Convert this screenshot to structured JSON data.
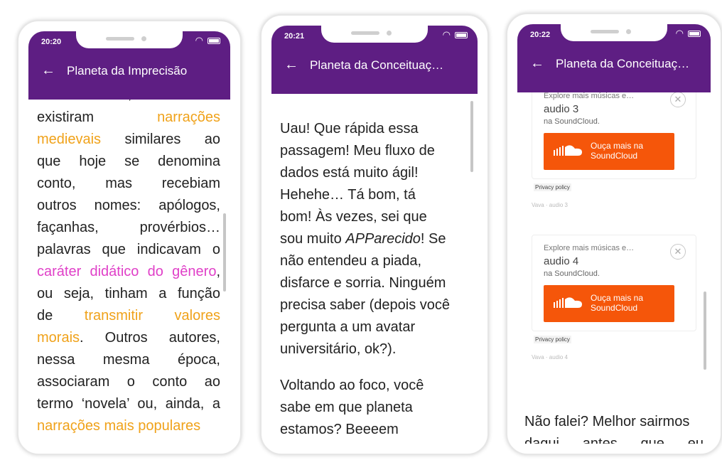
{
  "phones": [
    {
      "time": "20:20",
      "title": "Planeta da Imprecisão",
      "partial_top_line": "Renascimento, também",
      "lines": [
        [
          {
            "t": "existiram ",
            "c": ""
          },
          {
            "t": "narrações",
            "c": "orange"
          }
        ],
        [
          {
            "t": "medievais",
            "c": "orange"
          },
          {
            "t": " similares ao",
            "c": ""
          }
        ],
        [
          {
            "t": "que hoje se denomina",
            "c": ""
          }
        ],
        [
          {
            "t": "conto, mas recebiam",
            "c": ""
          }
        ],
        [
          {
            "t": "outros nomes: apólogos,",
            "c": ""
          }
        ],
        [
          {
            "t": "façanhas, provérbios…",
            "c": ""
          }
        ],
        [
          {
            "t": "palavras que indicavam o",
            "c": ""
          }
        ],
        [
          {
            "t": "caráter didático do gênero",
            "c": "pink"
          },
          {
            "t": ",",
            "c": ""
          }
        ],
        [
          {
            "t": "ou seja, tinham a função",
            "c": ""
          }
        ],
        [
          {
            "t": "de ",
            "c": ""
          },
          {
            "t": "transmitir valores",
            "c": "orange"
          }
        ],
        [
          {
            "t": "morais",
            "c": "orange"
          },
          {
            "t": ". Outros autores,",
            "c": ""
          }
        ],
        [
          {
            "t": "nessa mesma época,",
            "c": ""
          }
        ],
        [
          {
            "t": "associaram o conto ao",
            "c": ""
          }
        ],
        [
          {
            "t": "termo ‘novela’ ou, ainda, a",
            "c": ""
          }
        ],
        [
          {
            "t": "narrações mais populares",
            "c": "orange"
          }
        ]
      ]
    },
    {
      "time": "20:21",
      "title": "Planeta da Conceituaç…",
      "paragraph1_lines": [
        "Uau! Que rápida essa",
        "passagem! Meu fluxo de",
        "dados está muito ágil!",
        "Hehehe… Tá bom, tá",
        "bom! Às vezes, sei que"
      ],
      "line6_before": "sou muito ",
      "line6_italic": "APParecido",
      "line6_after": "! Se",
      "paragraph1_rest": [
        "não entendeu a piada,",
        "disfarce e sorria. Ninguém",
        "precisa saber (depois você",
        "pergunta a um avatar",
        "universitário, ok?)."
      ],
      "paragraph2_lines": [
        "Voltando ao foco, você",
        "sabe em que planeta",
        "estamos? Beeeem"
      ]
    },
    {
      "time": "20:22",
      "title": "Planeta da Conceituaç…",
      "widgets": [
        {
          "explore": "Explore mais músicas e…",
          "audio": "audio 3",
          "on": "na SoundCloud.",
          "button_line1": "Ouça mais na",
          "button_line2": "SoundCloud",
          "privacy": "Privacy policy",
          "caption": "Vava · audio 3"
        },
        {
          "explore": "Explore mais músicas e…",
          "audio": "audio 4",
          "on": "na SoundCloud.",
          "button_line1": "Ouça mais na",
          "button_line2": "SoundCloud",
          "privacy": "Privacy policy",
          "caption": "Vava · audio 4"
        }
      ],
      "bottom_lines": [
        "Não falei? Melhor sairmos",
        "daqui antes que eu"
      ]
    }
  ],
  "colors": {
    "appbar": "#5e1e83",
    "highlight_orange": "#f0a21a",
    "highlight_pink": "#e040c8",
    "soundcloud": "#f5560a"
  }
}
